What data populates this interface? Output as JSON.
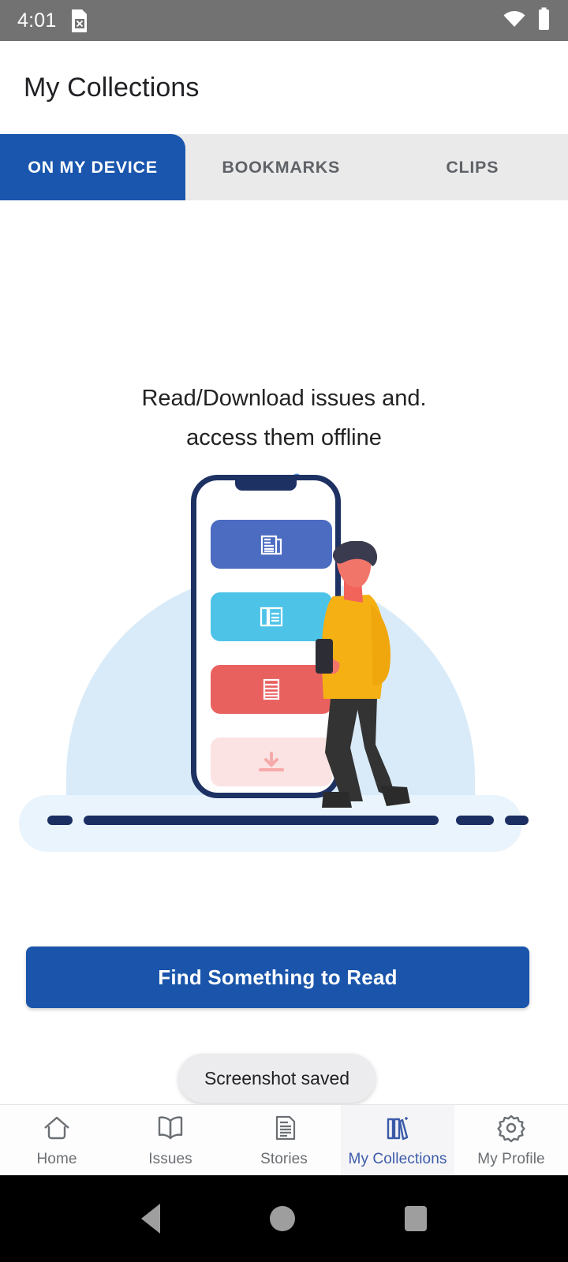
{
  "statusbar": {
    "time": "4:01",
    "sim_icon": "sim-card-no-signal-icon",
    "wifi_icon": "wifi-icon",
    "battery_icon": "battery-icon",
    "background_color": "#727272"
  },
  "appbar": {
    "title": "My Collections"
  },
  "tabs": {
    "active_color": "#1a56ad",
    "inactive_background": "#eaeaea",
    "items": [
      {
        "label": "ON MY DEVICE",
        "active": true
      },
      {
        "label": "BOOKMARKS",
        "active": false
      },
      {
        "label": "CLIPS",
        "active": false
      }
    ]
  },
  "empty_state": {
    "line1": "Read/Download issues and.",
    "line2": "access them offline",
    "illustration": {
      "wifi_off_icon": "wifi-off-icon",
      "wifi_off_color": "#4a8fd4",
      "blob_color": "#d9ebf9",
      "ground_color": "#1c2f63",
      "phone_frame_color": "#1e3163",
      "cards": [
        {
          "name": "newspaper-card",
          "color": "#4b6cc1",
          "icon": "newspaper-icon"
        },
        {
          "name": "magazine-card",
          "color": "#4ec3e8",
          "icon": "magazine-icon"
        },
        {
          "name": "article-card",
          "color": "#e8615f",
          "icon": "article-lines-icon"
        },
        {
          "name": "download-card",
          "color": "#fbe3e3",
          "icon": "download-arrow-icon"
        }
      ],
      "person": {
        "sweater_color": "#f5b014",
        "pants_color": "#333333",
        "hair_color": "#3b3b50",
        "skin_color": "#f2645a"
      }
    }
  },
  "cta": {
    "label": "Find Something to Read",
    "color": "#1a55ab"
  },
  "toast": {
    "message": "Screenshot saved"
  },
  "bottomnav": {
    "active_color": "#3b5ba9",
    "items": [
      {
        "label": "Home",
        "icon": "home-icon",
        "active": false
      },
      {
        "label": "Issues",
        "icon": "open-book-icon",
        "active": false
      },
      {
        "label": "Stories",
        "icon": "document-lines-icon",
        "active": false
      },
      {
        "label": "My Collections",
        "icon": "books-shelf-icon",
        "active": true
      },
      {
        "label": "My Profile",
        "icon": "gear-icon",
        "active": false
      }
    ]
  },
  "sysnav": {
    "back_icon": "triangle-back-icon",
    "home_icon": "circle-home-icon",
    "recents_icon": "square-recents-icon"
  }
}
